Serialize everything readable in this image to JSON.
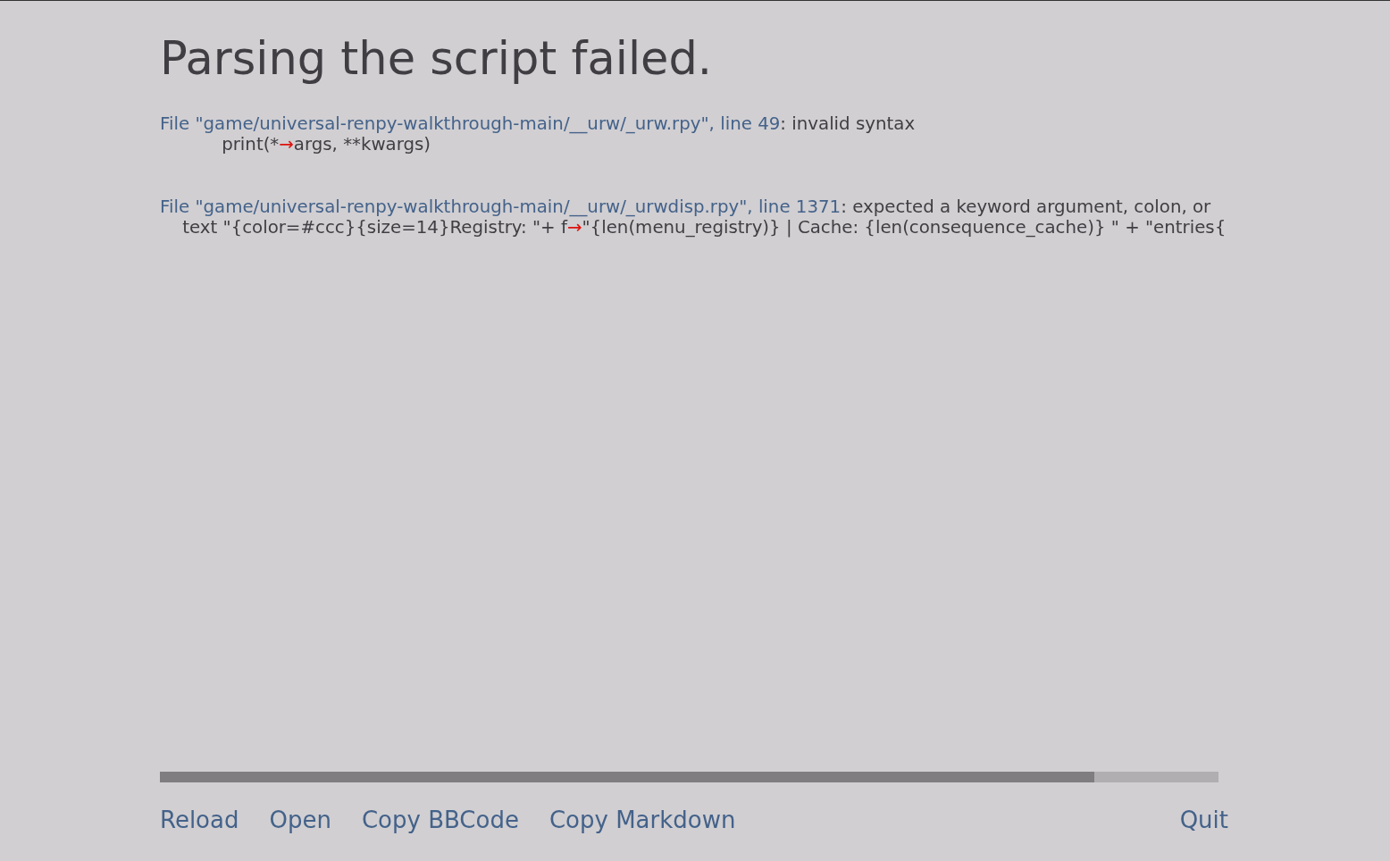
{
  "title": "Parsing the script failed.",
  "errors": [
    {
      "location": "File \"game/universal-renpy-walkthrough-main/__urw/_urw.rpy\", line 49",
      "message": ": invalid syntax",
      "code_before": "           print(*",
      "marker": "→",
      "code_after": "args, **kwargs)"
    },
    {
      "location": "File \"game/universal-renpy-walkthrough-main/__urw/_urwdisp.rpy\", line 1371",
      "message": ": expected a keyword argument, colon, or",
      "code_before": "    text \"{color=#ccc}{size=14}Registry: \"+ f",
      "marker": "→",
      "code_after": "\"{len(menu_registry)} | Cache: {len(consequence_cache)} \" + \"entries{"
    }
  ],
  "progress": {
    "level": 0.883
  },
  "buttons": [
    {
      "label": "Reload",
      "kind": "action"
    },
    {
      "label": "Open",
      "kind": "action"
    },
    {
      "label": "Copy BBCode",
      "kind": "action"
    },
    {
      "label": "Copy Markdown",
      "kind": "action"
    },
    {
      "label": "Quit",
      "kind": "quit"
    }
  ]
}
